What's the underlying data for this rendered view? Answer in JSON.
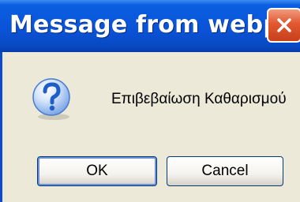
{
  "window": {
    "title": "Message from webpage",
    "close_icon": "close-x-icon"
  },
  "dialog": {
    "icon": "question-icon",
    "message": "Επιβεβαίωση Καθαρισμού"
  },
  "buttons": {
    "ok_label": "OK",
    "cancel_label": "Cancel"
  },
  "colors": {
    "titlebar": "#0a53d8",
    "close_button": "#e2582f",
    "dialog_background": "#ece9d8",
    "question_icon": "#2f6fd6"
  }
}
